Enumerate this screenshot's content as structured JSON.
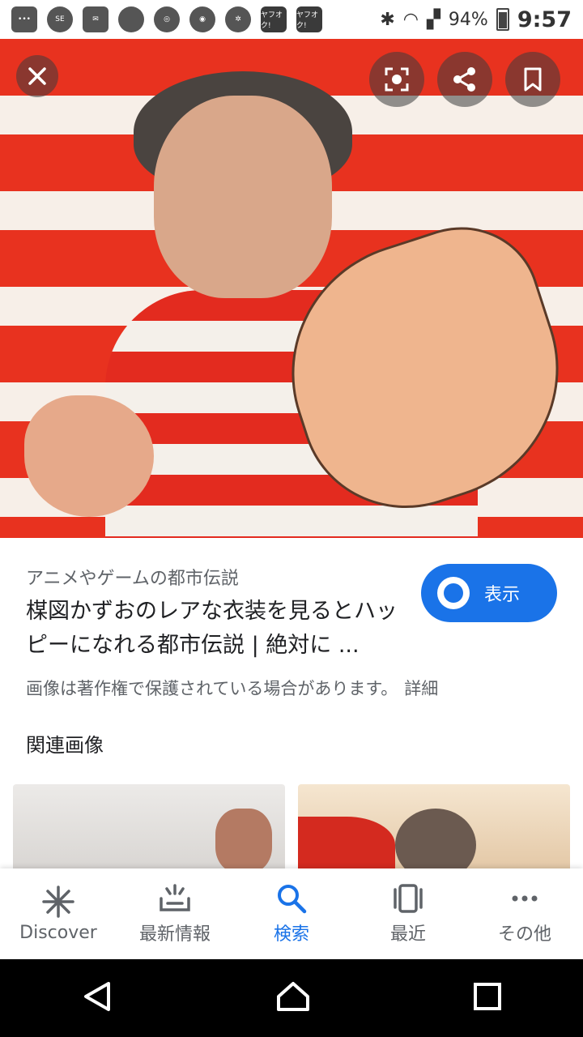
{
  "status_bar": {
    "icons": [
      "message-icon",
      "se-icon",
      "mail-icon",
      "circle-icon",
      "app-icon",
      "chrome-icon",
      "wheel-icon",
      "yahuoku-icon",
      "yahuoku-icon"
    ],
    "app_labels": [
      "SE",
      "ヤフオク!",
      "ヤフオク!"
    ],
    "battery": "94%",
    "time": "9:57"
  },
  "hero": {
    "close_label": "close",
    "lens_label": "lens",
    "share_label": "share",
    "bookmark_label": "bookmark"
  },
  "result": {
    "source": "アニメやゲームの都市伝説",
    "title": "楳図かずおのレアな衣装を見るとハッピーになれる都市伝説 | 絶対に ...",
    "show_button": "表示",
    "copyright": "画像は著作権で保護されている場合があります。",
    "details": "詳細",
    "related_heading": "関連画像"
  },
  "bottom_nav": {
    "items": [
      {
        "label": "Discover",
        "icon": "asterisk-icon"
      },
      {
        "label": "最新情報",
        "icon": "updates-icon"
      },
      {
        "label": "検索",
        "icon": "search-icon"
      },
      {
        "label": "最近",
        "icon": "recents-icon"
      },
      {
        "label": "その他",
        "icon": "more-icon"
      }
    ],
    "active_index": 2
  },
  "colors": {
    "accent": "#1a73e8",
    "text_primary": "#202124",
    "text_secondary": "#5f6368"
  }
}
